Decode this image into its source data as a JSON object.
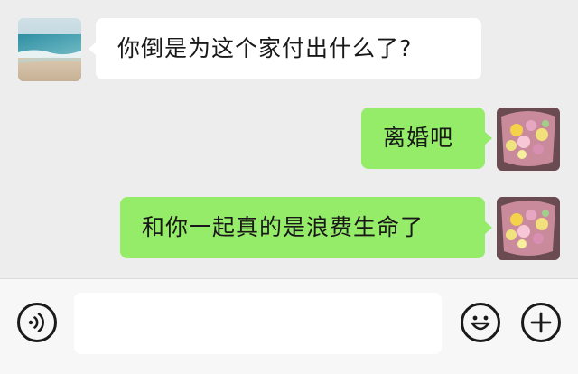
{
  "conversation": {
    "messages": [
      {
        "sender": "contact",
        "text": "你倒是为这个家付出什么了?"
      },
      {
        "sender": "me",
        "text": "离婚吧"
      },
      {
        "sender": "me",
        "text": "和你一起真的是浪费生命了"
      }
    ]
  },
  "input_bar": {
    "voice_icon": "voice-icon",
    "message_value": "",
    "emoji_icon": "emoji-icon",
    "add_icon": "plus-icon"
  },
  "colors": {
    "chat_background": "#ededed",
    "incoming_bubble": "#ffffff",
    "outgoing_bubble": "#95ec69",
    "input_bar_background": "#f7f7f7"
  }
}
